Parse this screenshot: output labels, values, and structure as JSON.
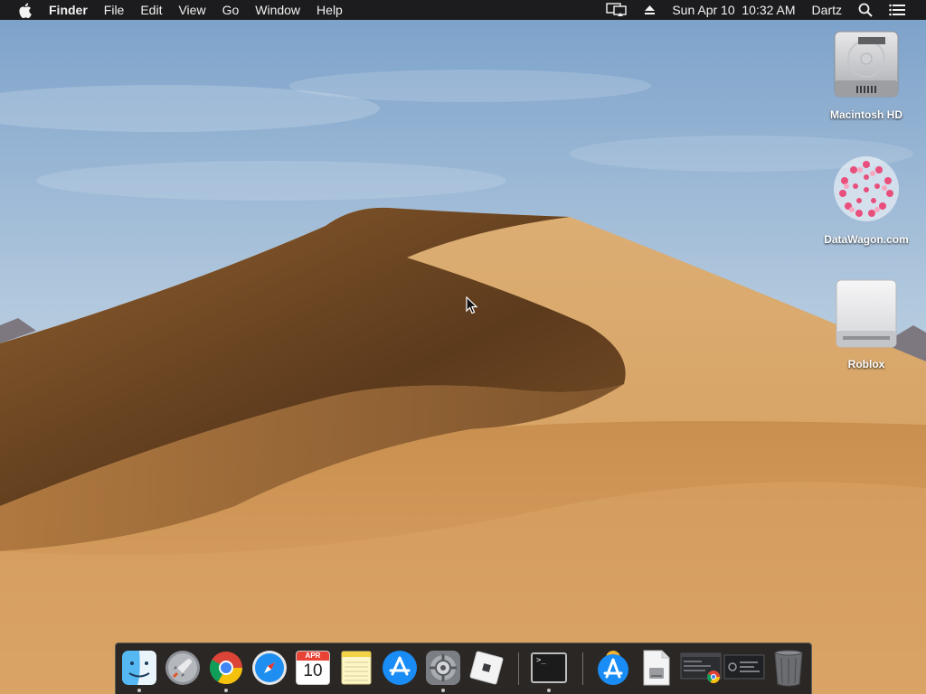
{
  "menubar": {
    "apple_icon": "apple-logo-icon",
    "app_name": "Finder",
    "menus": [
      "File",
      "Edit",
      "View",
      "Go",
      "Window",
      "Help"
    ],
    "status": {
      "airplay_icon": "airplay-display-icon",
      "eject_icon": "eject-icon",
      "clock": "Sun Apr 10  10:32 AM",
      "user": "Dartz",
      "search_icon": "spotlight-search-icon",
      "notifications_icon": "notification-center-icon"
    }
  },
  "desktop": {
    "wallpaper": "macOS Mojave day desert dune",
    "icons": [
      {
        "label": "Macintosh HD",
        "icon": "hard-drive-icon"
      },
      {
        "label": "DataWagon.com",
        "icon": "pink-floral-pattern-icon"
      },
      {
        "label": "Roblox",
        "icon": "external-drive-icon"
      }
    ]
  },
  "dock": {
    "apps": [
      {
        "name": "Finder",
        "icon": "finder-icon",
        "running": true
      },
      {
        "name": "Launchpad",
        "icon": "launchpad-rocket-icon",
        "running": false
      },
      {
        "name": "Google Chrome",
        "icon": "chrome-icon",
        "running": true
      },
      {
        "name": "Safari",
        "icon": "safari-compass-icon",
        "running": false
      },
      {
        "name": "Calendar",
        "icon": "calendar-icon",
        "running": false,
        "month": "APR",
        "day": "10"
      },
      {
        "name": "Notes",
        "icon": "notes-icon",
        "running": false
      },
      {
        "name": "App Store",
        "icon": "app-store-icon",
        "running": false
      },
      {
        "name": "System Preferences",
        "icon": "system-preferences-gear-icon",
        "running": true
      },
      {
        "name": "Roblox",
        "icon": "roblox-icon",
        "running": false
      },
      {
        "name": "Terminal",
        "icon": "terminal-icon",
        "running": true,
        "prompt": ">_"
      }
    ],
    "stacks": [
      {
        "name": "Applications",
        "icon": "applications-folder-icon"
      },
      {
        "name": "Install Disk",
        "icon": "disk-image-document-icon"
      },
      {
        "name": "Minimized Window 1",
        "icon": "minimized-window-chrome-icon"
      },
      {
        "name": "Minimized Window 2",
        "icon": "minimized-window-icon"
      },
      {
        "name": "Trash",
        "icon": "trash-icon"
      }
    ]
  },
  "colors": {
    "menubar_bg": "#1c1c1e",
    "sky_top": "#7fa3c9",
    "sand": "#d9a566",
    "dune_shadow": "#6b4523"
  }
}
